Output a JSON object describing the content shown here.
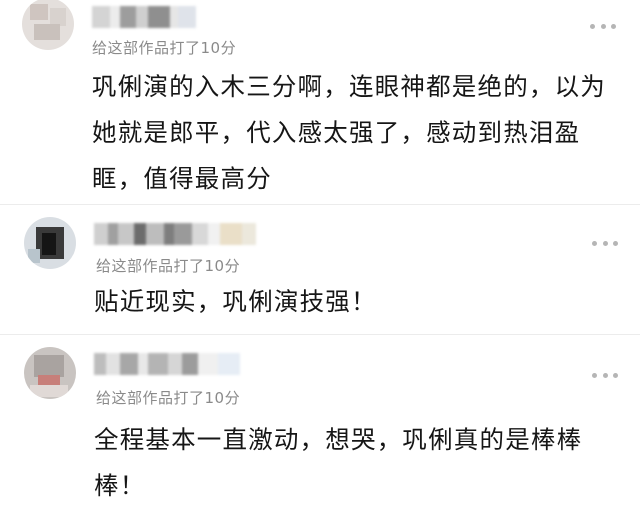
{
  "comments": [
    {
      "rating_text": "给这部作品打了10分",
      "text": "巩俐演的入木三分啊，连眼神都是绝的，以为她就是郎平，代入感太强了，感动到热泪盈眶，值得最高分"
    },
    {
      "rating_text": "给这部作品打了10分",
      "text": "贴近现实，巩俐演技强！"
    },
    {
      "rating_text": "给这部作品打了10分",
      "text": "全程基本一直激动，想哭，巩俐真的是棒棒棒！"
    }
  ],
  "icons": {
    "more": "more-dots-icon"
  },
  "colors": {
    "rating_gray": "#8a8a8a",
    "text": "#161616",
    "dots": "#b5b5b5"
  }
}
